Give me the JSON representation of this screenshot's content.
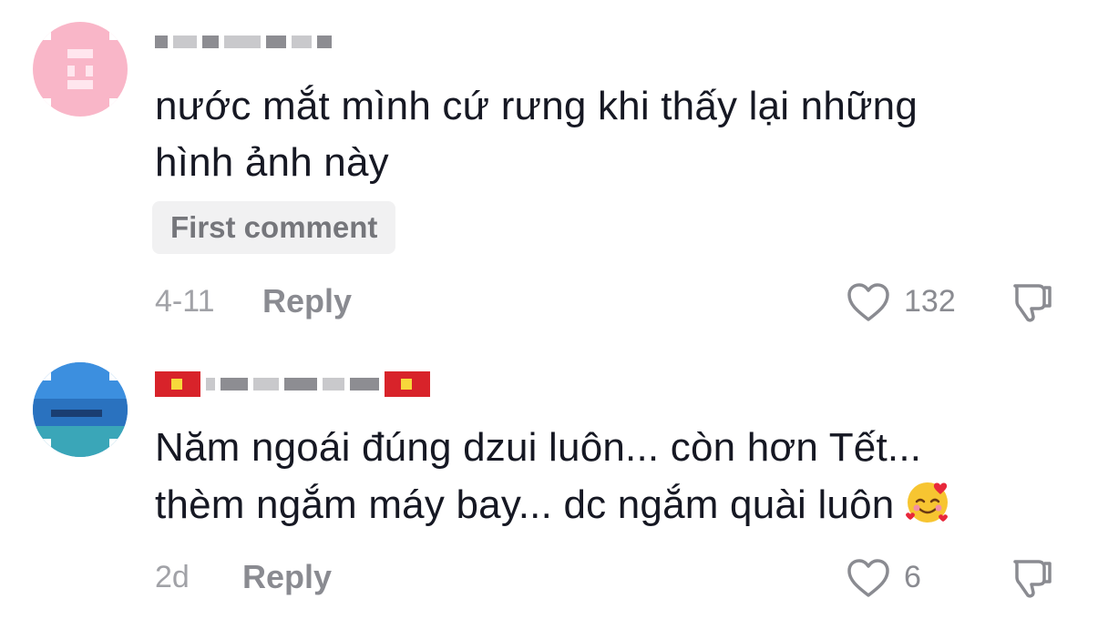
{
  "comments": [
    {
      "text_line1": "nước mắt mình cứ rưng khi thấy lại những",
      "text_line2": "hình ảnh này",
      "badge": "First comment",
      "date": "4-11",
      "reply_label": "Reply",
      "likes": "132"
    },
    {
      "text_line1": "Năm ngoái đúng dzui luôn... còn hơn Tết...",
      "text_line2": "thèm ngắm máy bay... dc ngắm quài luôn",
      "date": "2d",
      "reply_label": "Reply",
      "likes": "6",
      "emoji": "smiling-face-with-hearts-icon"
    }
  ],
  "colors": {
    "text": "#161823",
    "muted": "#8a8b91",
    "badge_bg": "#f1f1f2"
  }
}
